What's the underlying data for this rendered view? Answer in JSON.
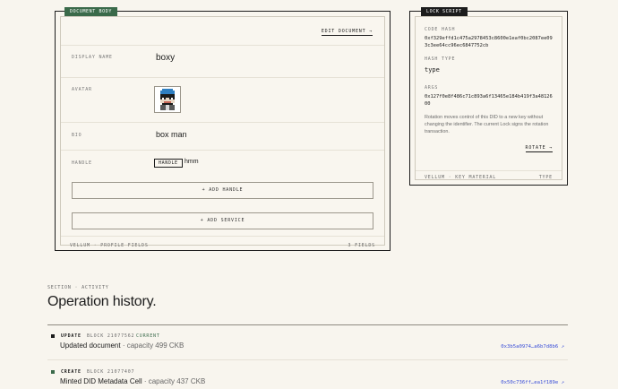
{
  "doc_card": {
    "tag": "DOCUMENT BODY",
    "edit_link": "EDIT DOCUMENT →",
    "fields": {
      "display_name_label": "DISPLAY NAME",
      "display_name_value": "boxy",
      "avatar_label": "AVATAR",
      "bio_label": "BIO",
      "bio_value": "box man",
      "handle_label": "HANDLE",
      "handle_badge": "HANDLE",
      "handle_value": "hmm"
    },
    "add_handle": "+ ADD HANDLE",
    "add_service": "+ ADD SERVICE",
    "footer_left": "VELLUM · PROFILE FIELDS",
    "footer_right": "3 FIELDS"
  },
  "lock_card": {
    "tag": "LOCK SCRIPT",
    "code_hash_label": "CODE HASH",
    "code_hash_value": "0xf329effd1c475a2978453c8600e1eaf0bc2087ee093c3ee64cc96ec6847752cb",
    "hash_type_label": "HASH TYPE",
    "hash_type_value": "type",
    "args_label": "ARGS",
    "args_value": "0x127f0e8f486c71c893a6f13465e184b419f3a4812600",
    "note": "Rotation moves control of this DID to a new key without changing the identifier. The current Lock signs the rotation transaction.",
    "rotate_link": "ROTATE →",
    "footer_left": "VELLUM · KEY MATERIAL",
    "footer_right": "TYPE"
  },
  "activity": {
    "eyebrow": "SECTION · ACTIVITY",
    "title": "Operation history.",
    "items": [
      {
        "kind": "UPDATE",
        "block": "BLOCK 21077562",
        "status": "CURRENT",
        "text": "Updated document",
        "capacity": " · capacity 499 CKB",
        "tx": "0x3b5a0974…a6b7d8b6 ↗"
      },
      {
        "kind": "CREATE",
        "block": "BLOCK 21077407",
        "status": "",
        "text": "Minted DID Metadata Cell",
        "capacity": " · capacity 437 CKB",
        "tx": "0x50c736ff…ea1f189e ↗"
      }
    ]
  },
  "colors": {
    "accent_green": "#3a6a4a",
    "link_blue": "#3b4fd8",
    "ink": "#1c1c1c",
    "paper": "#f8f5ee"
  },
  "icons": {
    "avatar": "pixel-avatar-icon",
    "update_marker": "square-marker-icon",
    "create_marker": "green-square-marker-icon"
  }
}
